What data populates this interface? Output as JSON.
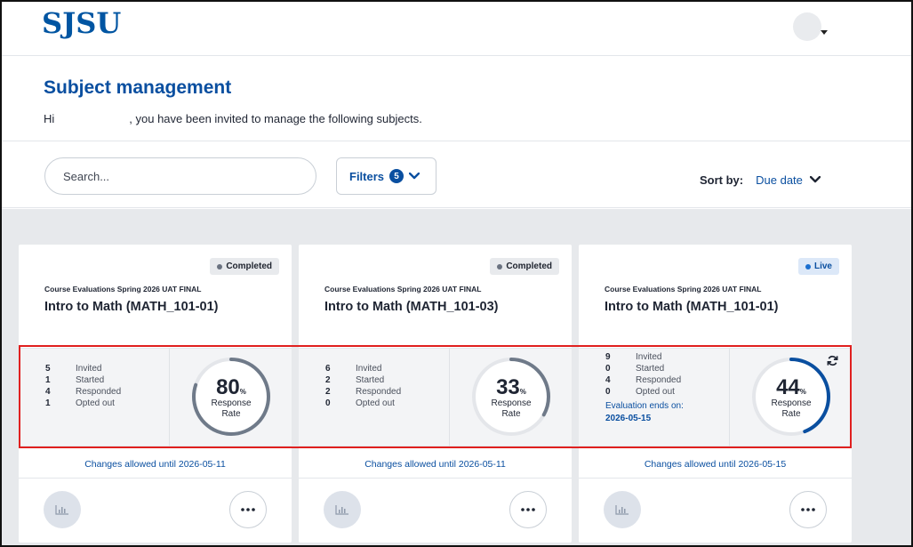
{
  "header": {
    "logo": "SJSU",
    "avatar_icon": "user-avatar"
  },
  "page": {
    "title": "Subject management",
    "greeting_prefix": "Hi",
    "greeting_suffix": ", you have been invited to manage the following subjects."
  },
  "controls": {
    "search_placeholder": "Search...",
    "filters_label": "Filters",
    "filters_count": "5",
    "sort_label": "Sort by:",
    "sort_value": "Due date"
  },
  "colors": {
    "brand": "#0055a2",
    "link": "#0a4fa0",
    "highlight": "#e0201f",
    "ring_completed": "#6f7a89",
    "ring_live": "#0a4fa0"
  },
  "cards": [
    {
      "status": "Completed",
      "survey": "Course Evaluations Spring 2026 UAT FINAL",
      "course": "Intro to Math (MATH_101-01)",
      "stats": [
        {
          "num": "5",
          "label": "Invited"
        },
        {
          "num": "1",
          "label": "Started"
        },
        {
          "num": "4",
          "label": "Responded"
        },
        {
          "num": "1",
          "label": "Opted out"
        }
      ],
      "rate": "80",
      "rate_unit": "%",
      "rate_fraction": 0.8,
      "rate_label_1": "Response",
      "rate_label_2": "Rate",
      "changes": "Changes allowed until 2026-05-11"
    },
    {
      "status": "Completed",
      "survey": "Course Evaluations Spring 2026 UAT FINAL",
      "course": "Intro to Math (MATH_101-03)",
      "stats": [
        {
          "num": "6",
          "label": "Invited"
        },
        {
          "num": "2",
          "label": "Started"
        },
        {
          "num": "2",
          "label": "Responded"
        },
        {
          "num": "0",
          "label": "Opted out"
        }
      ],
      "rate": "33",
      "rate_unit": "%",
      "rate_fraction": 0.33,
      "rate_label_1": "Response",
      "rate_label_2": "Rate",
      "changes": "Changes allowed until 2026-05-11"
    },
    {
      "status": "Live",
      "survey": "Course Evaluations Spring 2026 UAT FINAL",
      "course": "Intro to Math (MATH_101-01)",
      "stats": [
        {
          "num": "9",
          "label": "Invited"
        },
        {
          "num": "0",
          "label": "Started"
        },
        {
          "num": "4",
          "label": "Responded"
        },
        {
          "num": "0",
          "label": "Opted out"
        }
      ],
      "ends_label": "Evaluation ends on:",
      "ends_date": "2026-05-15",
      "rate": "44",
      "rate_unit": "%",
      "rate_fraction": 0.44,
      "rate_label_1": "Response",
      "rate_label_2": "Rate",
      "changes": "Changes allowed until 2026-05-15"
    }
  ]
}
